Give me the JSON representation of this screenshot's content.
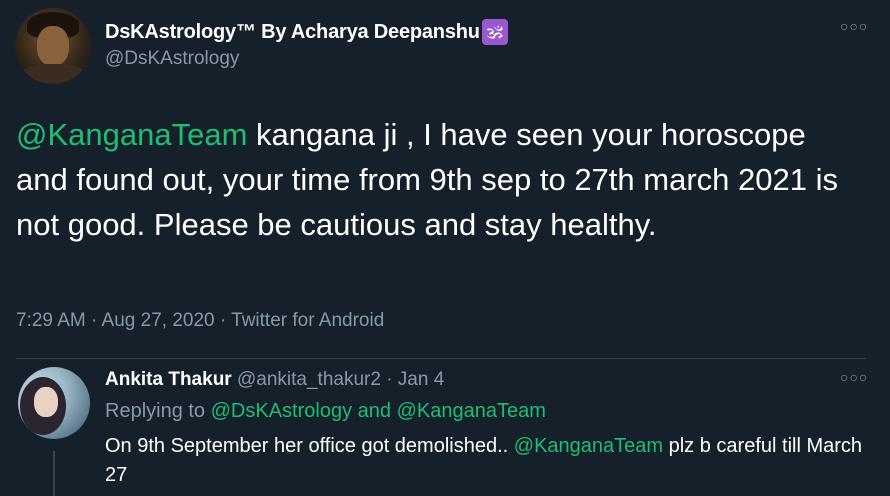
{
  "main_tweet": {
    "display_name": "DsKAstrology™ By Acharya Deepanshu",
    "badge": "🕉",
    "handle": "@DsKAstrology",
    "more_icon": "more-dots-icon",
    "mention": "@KanganaTeam",
    "text": " kangana ji , I have seen your horoscope and found out, your time from 9th sep to 27th march 2021 is not good. Please be cautious and stay healthy.",
    "meta": "7:29 AM · Aug 27, 2020 · Twitter for Android"
  },
  "reply": {
    "display_name": "Ankita Thakur",
    "handle_date": "@ankita_thakur2 · Jan 4",
    "more_icon": "more-dots-icon",
    "replying_prefix": "Replying to",
    "replying_mentions": "@DsKAstrology and @KanganaTeam",
    "text_before": "On 9th September her office got demolished.. ",
    "text_mention": "@KanganaTeam",
    "text_after": " plz b careful till March 27"
  },
  "colors": {
    "background": "#15202b",
    "mention": "#1fbd73",
    "secondary": "#8899a6",
    "divider": "#38444d"
  }
}
